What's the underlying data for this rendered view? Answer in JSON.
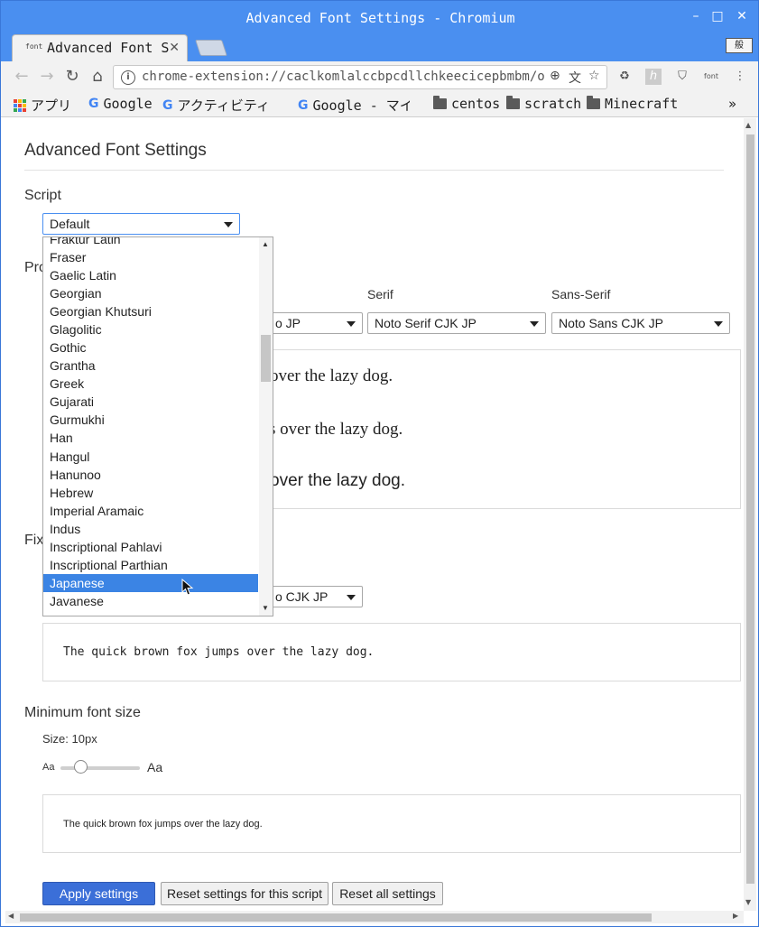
{
  "window": {
    "title": "Advanced Font Settings - Chromium",
    "controls": {
      "minimize": "–",
      "maximize": "□",
      "close": "✕"
    }
  },
  "tab": {
    "favicon": "font",
    "title": "Advanced Font Se",
    "close": "✕"
  },
  "ime_indicator": "般",
  "toolbar": {
    "url": "chrome-extension://caclkomlalccbpcdllchkeecicepbmbm/options.html"
  },
  "bookmarks": [
    {
      "label": "アプリ",
      "icon": "apps-icon"
    },
    {
      "label": "Google",
      "icon": "google-icon"
    },
    {
      "label": "アクティビティ",
      "icon": "google-icon"
    },
    {
      "label": "Google - マイ",
      "icon": "google-icon"
    },
    {
      "label": "centos",
      "icon": "folder-icon"
    },
    {
      "label": "scratch",
      "icon": "folder-icon"
    },
    {
      "label": "Minecraft",
      "icon": "folder-icon"
    }
  ],
  "bookmarks_overflow": "»",
  "page": {
    "title": "Advanced Font Settings",
    "script_heading": "Script",
    "script_selected": "Default",
    "proportional_heading": "Pro",
    "fixed_heading": "Fix",
    "columns": {
      "serif": "Serif",
      "sans_serif": "Sans-Serif"
    },
    "standard_font_partial": "o JP",
    "serif_font": "Noto Serif CJK JP",
    "sans_font": "Noto Sans CJK JP",
    "fixed_font_partial": "o CJK JP",
    "proportional_samples": [
      "over the lazy dog.",
      "s over the lazy dog.",
      "over the lazy dog."
    ],
    "fixed_sample": "The quick brown fox jumps over the lazy dog.",
    "min_font_heading": "Minimum font size",
    "min_font_size_label": "Size: 10px",
    "slider_small": "Aa",
    "slider_large": "Aa",
    "min_font_value_fraction": 0.2,
    "min_sample": "The quick brown fox jumps over the lazy dog.",
    "buttons": {
      "apply": "Apply settings",
      "reset_script": "Reset settings for this script",
      "reset_all": "Reset all settings"
    }
  },
  "dropdown": {
    "partial_top": "Fraktur Latin",
    "options": [
      "Fraser",
      "Gaelic Latin",
      "Georgian",
      "Georgian Khutsuri",
      "Glagolitic",
      "Gothic",
      "Grantha",
      "Greek",
      "Gujarati",
      "Gurmukhi",
      "Han",
      "Hangul",
      "Hanunoo",
      "Hebrew",
      "Imperial Aramaic",
      "Indus",
      "Inscriptional Pahlavi",
      "Inscriptional Parthian",
      "Japanese",
      "Javanese"
    ],
    "highlighted": "Japanese"
  },
  "colors": {
    "titlebar": "#4a8ff0",
    "selection": "#3b84e4",
    "primary_button": "#3b6fd8"
  }
}
